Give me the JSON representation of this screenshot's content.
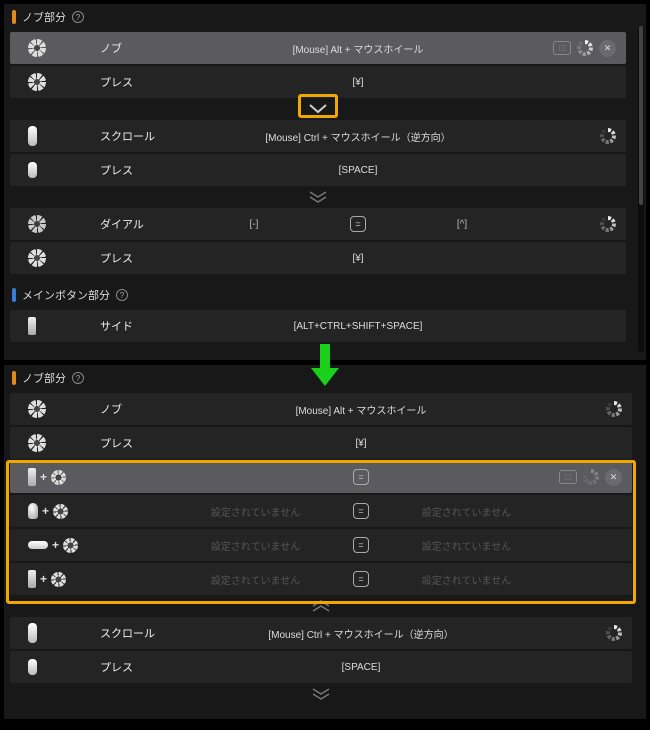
{
  "colors": {
    "highlight": "#f0a800",
    "arrow": "#22dd22"
  },
  "top": {
    "knob": {
      "header": "ノブ部分",
      "rows": [
        {
          "label": "ノブ",
          "center": "[Mouse] Alt + マウスホイール",
          "actions": [
            "badge",
            "spinner",
            "close"
          ],
          "selected": true
        },
        {
          "label": "プレス",
          "center": "[¥]"
        }
      ],
      "scroll_rows": [
        {
          "label": "スクロール",
          "center": "[Mouse] Ctrl + マウスホイール（逆方向）",
          "actions": [
            "spinner"
          ]
        },
        {
          "label": "プレス",
          "center": "[SPACE]"
        }
      ],
      "dial_rows": [
        {
          "label": "ダイアル",
          "left": "[-]",
          "center_key": "=",
          "right": "[^]",
          "actions": [
            "spinner"
          ]
        },
        {
          "label": "プレス",
          "center": "[¥]"
        }
      ]
    },
    "main": {
      "header": "メインボタン部分",
      "rows": [
        {
          "label": "サイド",
          "center": "[ALT+CTRL+SHIFT+SPACE]"
        }
      ]
    }
  },
  "bottom": {
    "knob": {
      "header": "ノブ部分",
      "rows": [
        {
          "label": "ノブ",
          "center": "[Mouse] Alt + マウスホイール",
          "actions": [
            "spinner"
          ]
        },
        {
          "label": "プレス",
          "center": "[¥]"
        }
      ],
      "combo_rows": [
        {
          "center_key": "=",
          "actions": [
            "badge",
            "spinner-dim",
            "close"
          ],
          "selected": true
        },
        {
          "left": "設定されていません",
          "center_key": "=",
          "right": "設定されていません"
        },
        {
          "left": "設定されていません",
          "center_key": "=",
          "right": "設定されていません"
        },
        {
          "left": "設定されていません",
          "center_key": "=",
          "right": "設定されていません"
        }
      ],
      "scroll_rows": [
        {
          "label": "スクロール",
          "center": "[Mouse] Ctrl + マウスホイール（逆方向）",
          "actions": [
            "spinner"
          ]
        },
        {
          "label": "プレス",
          "center": "[SPACE]"
        }
      ]
    }
  },
  "unset_text": "設定されていません"
}
